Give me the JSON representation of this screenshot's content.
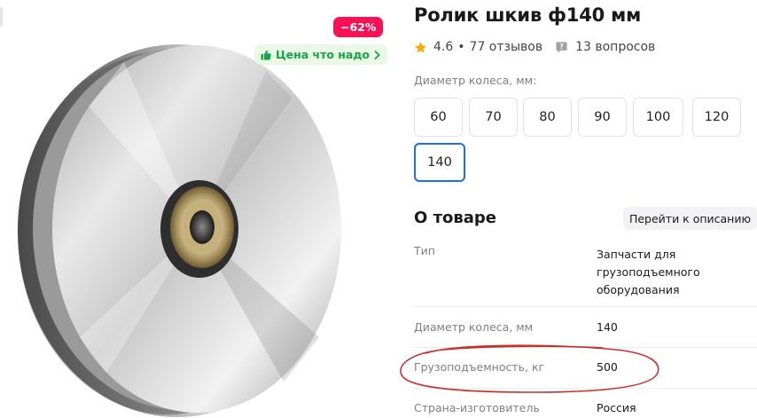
{
  "badges": {
    "discount": "−62%",
    "price_tag": "Цена что надо"
  },
  "product": {
    "title": "Ролик шкив ф140 мм",
    "rating": "4.6",
    "reviews": "77 отзывов",
    "questions": "13 вопросов",
    "rating_separator": "•"
  },
  "diameter": {
    "label": "Диаметр колеса, мм:",
    "options": [
      "60",
      "70",
      "80",
      "90",
      "100",
      "120",
      "140"
    ],
    "selected": "140"
  },
  "about": {
    "title": "О товаре",
    "go_to_description": "Перейти к описанию",
    "specs": [
      {
        "name": "Тип",
        "value_lines": [
          "Запчасти для",
          "грузоподъемного",
          "оборудования"
        ]
      },
      {
        "name": "Диаметр колеса, мм",
        "value": "140"
      },
      {
        "name": "Грузоподъемность, кг",
        "value": "500"
      },
      {
        "name": "Страна-изготовитель",
        "value": "Россия"
      }
    ]
  },
  "colors": {
    "discount_badge": "#f91155",
    "price_badge_bg": "#eaf9e6",
    "price_badge_text": "#16a34a",
    "star": "#ffa800",
    "selected_border": "#1a6ef0",
    "highlight_oval": "#c9302c"
  },
  "icons": {
    "price_badge": "thumbs-up-icon",
    "price_badge_arrow": "chevron-right-icon",
    "rating": "star-icon",
    "questions": "question-bubble-icon"
  }
}
